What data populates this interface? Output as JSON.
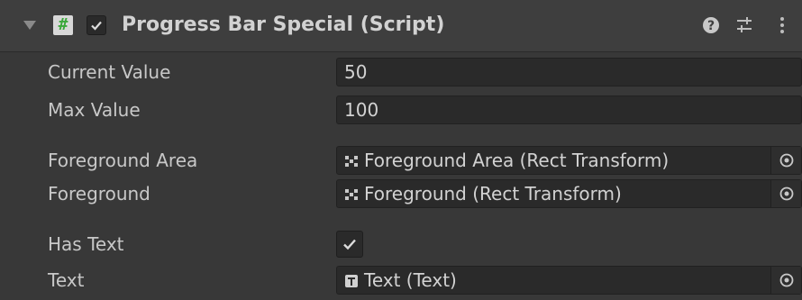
{
  "component": {
    "title": "Progress Bar Special (Script)",
    "enabled": true,
    "script_icon": "script-hash-icon",
    "header_icons": [
      "help-icon",
      "presets-icon",
      "context-menu-icon"
    ]
  },
  "fields": {
    "current_value": {
      "label": "Current Value",
      "value": "50"
    },
    "max_value": {
      "label": "Max Value",
      "value": "100"
    },
    "foreground_area": {
      "label": "Foreground Area",
      "value": "Foreground Area (Rect Transform)",
      "icon": "rect-transform-icon"
    },
    "foreground": {
      "label": "Foreground",
      "value": "Foreground (Rect Transform)",
      "icon": "rect-transform-icon"
    },
    "has_text": {
      "label": "Has Text",
      "checked": true
    },
    "text": {
      "label": "Text",
      "value": "Text (Text)",
      "icon": "text-component-icon"
    }
  },
  "colors": {
    "background": "#383838",
    "header": "#3e3e3e",
    "field": "#2a2a2a",
    "script_icon_green": "#3aa83a"
  }
}
